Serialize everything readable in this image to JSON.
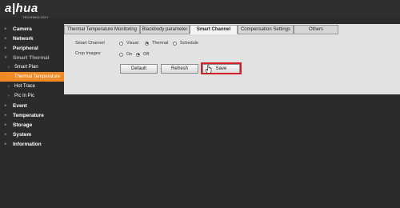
{
  "brand": {
    "name": "a|hua",
    "tagline": "TECHNOLOGY"
  },
  "sidebar": {
    "items": [
      {
        "label": "Camera"
      },
      {
        "label": "Network"
      },
      {
        "label": "Peripheral"
      },
      {
        "label": "Smart Thermal"
      },
      {
        "label": "Smart Plan"
      },
      {
        "label": "Thermal Temperature"
      },
      {
        "label": "Hot Trace"
      },
      {
        "label": "Pic In Pic"
      },
      {
        "label": "Event"
      },
      {
        "label": "Temperature"
      },
      {
        "label": "Storage"
      },
      {
        "label": "System"
      },
      {
        "label": "Information"
      }
    ],
    "active_index": 5
  },
  "tabs": [
    {
      "label": "Thermal Temperature Monitoring"
    },
    {
      "label": "Blackbody parameter"
    },
    {
      "label": "Smart Channel"
    },
    {
      "label": "Compensation Settings"
    },
    {
      "label": "Others"
    }
  ],
  "active_tab": 2,
  "form": {
    "smart_channel": {
      "label": "Smart Channel",
      "options": [
        "Visual",
        "Thermal",
        "Schedule"
      ],
      "selected": "Thermal"
    },
    "crop_images": {
      "label": "Crop Images",
      "options": [
        "On",
        "Off"
      ],
      "selected": "Off"
    }
  },
  "buttons": {
    "default": "Default",
    "refresh": "Refresh",
    "save": "Save"
  },
  "colors": {
    "accent": "#f08a24",
    "highlight": "#d3202a",
    "panel": "#e2e2e2",
    "background": "#2b2b2b"
  }
}
